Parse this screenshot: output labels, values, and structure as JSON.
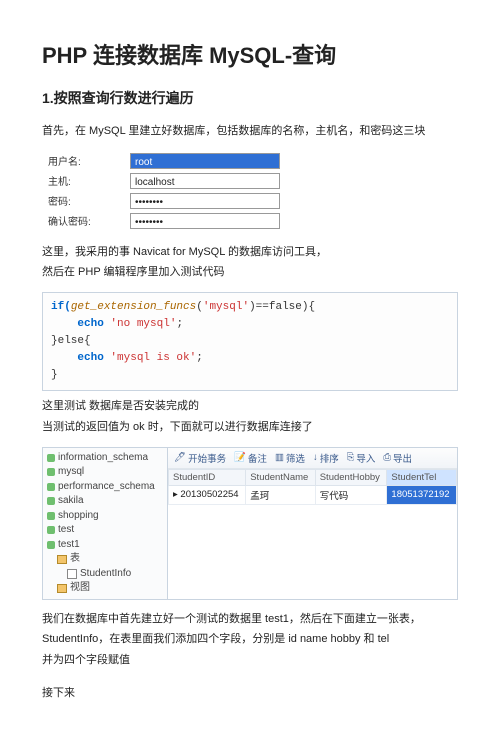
{
  "title": "PHP 连接数据库 MySQL-查询",
  "section1_heading": "1.按照查询行数进行遍历",
  "intro": "首先，在 MySQL 里建立好数据库，包括数据库的名称，主机名，和密码这三块",
  "form": {
    "user_label": "用户名:",
    "user_value": "root",
    "host_label": "主机:",
    "host_value": "localhost",
    "pwd_label": "密码:",
    "pwd_value": "••••••••",
    "pwd2_label": "确认密码:",
    "pwd2_value": "••••••••"
  },
  "para_tool_1": "这里，我采用的事 Navicat for MySQL 的数据库访问工具，",
  "para_tool_2": "然后在 PHP 编辑程序里加入测试代码",
  "code": {
    "l1_a": "if(",
    "l1_b": "get_extension_funcs",
    "l1_c": "(",
    "l1_d": "'mysql'",
    "l1_e": ")==false){",
    "l2_a": "    echo ",
    "l2_b": "'no mysql'",
    "l2_c": ";",
    "l3": "}else{",
    "l4_a": "    echo ",
    "l4_b": "'mysql is ok'",
    "l4_c": ";",
    "l5": "}"
  },
  "para_test_1": "这里测试 数据库是否安装完成的",
  "para_test_2": "当测试的返回值为 ok 时，下面就可以进行数据库连接了",
  "tree": {
    "items": [
      "information_schema",
      "mysql",
      "performance_schema",
      "sakila",
      "shopping",
      "test",
      "test1"
    ],
    "sub_tables": "表",
    "sub_item": "StudentInfo",
    "sub_views": "视图"
  },
  "toolbar": {
    "begin": "开始事务",
    "memo": "备注",
    "filter": "筛选",
    "sort": "排序",
    "import": "导入",
    "export": "导出"
  },
  "grid": {
    "cols": [
      "StudentID",
      "StudentName",
      "StudentHobby",
      "StudentTel"
    ],
    "row": [
      "20130502254",
      "孟珂",
      "写代码",
      "18051372192"
    ]
  },
  "para_after_1": "我们在数据库中首先建立好一个测试的数据里 test1，然后在下面建立一张表，",
  "para_after_2": "StudentInfo，在表里面我们添加四个字段，分别是 id name hobby 和 tel",
  "para_after_3": "并为四个字段赋值",
  "para_next": "接下来"
}
